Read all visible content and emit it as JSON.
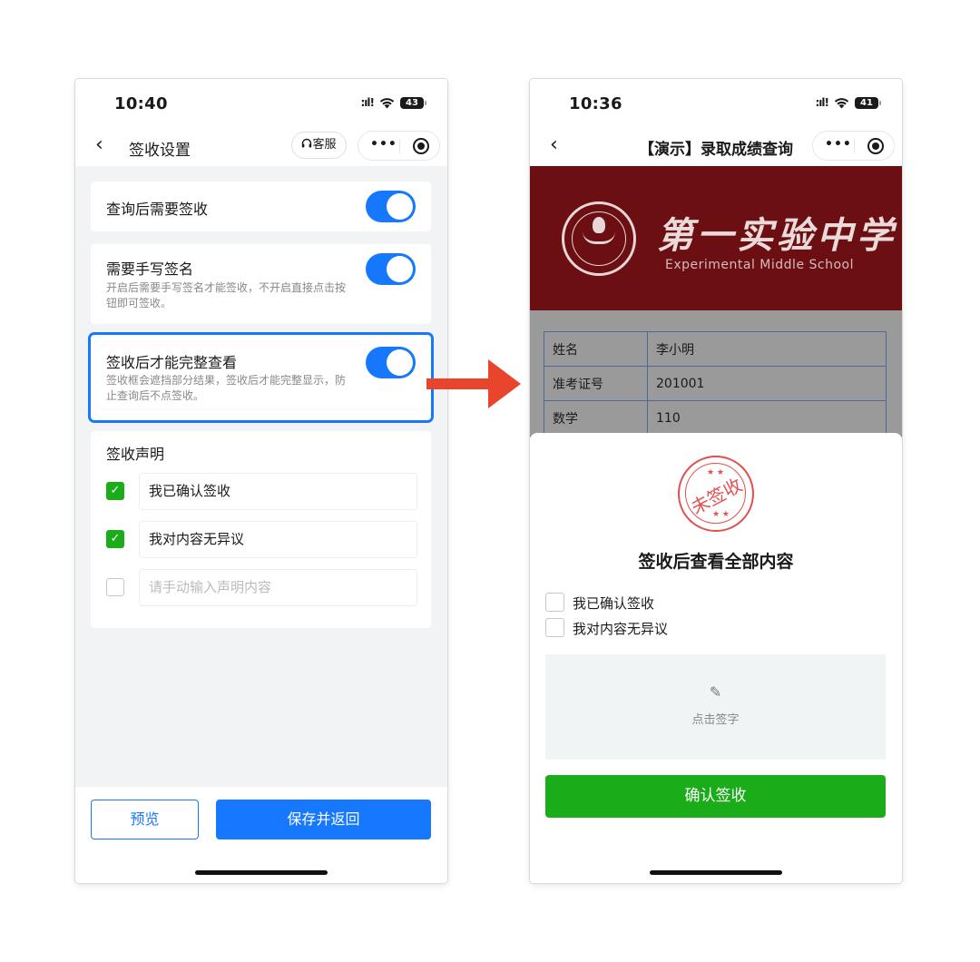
{
  "left": {
    "status": {
      "time": "10:40",
      "signal": ":ıl!",
      "wifi": "wifi-icon",
      "battery": "43"
    },
    "nav": {
      "back": "‹",
      "title": "签收设置",
      "kefu": "客服",
      "more": "•••"
    },
    "settings": [
      {
        "title": "查询后需要签收",
        "desc": "",
        "enabled": true
      },
      {
        "title": "需要手写签名",
        "desc": "开启后需要手写签名才能签收，不开启直接点击按钮即可签收。",
        "enabled": true
      },
      {
        "title": "签收后才能完整查看",
        "desc": "签收框会遮挡部分结果，签收后才能完整显示，防止查询后不点签收。",
        "enabled": true,
        "highlighted": true
      }
    ],
    "statement": {
      "title": "签收声明",
      "items": [
        {
          "text": "我已确认签收",
          "checked": true,
          "check_mark": "✓"
        },
        {
          "text": "我对内容无异议",
          "checked": true,
          "check_mark": "✓"
        },
        {
          "text": "请手动输入声明内容",
          "checked": false,
          "placeholder": true
        }
      ]
    },
    "buttons": {
      "preview": "预览",
      "save": "保存并返回"
    },
    "colors": {
      "primary": "#1677ff",
      "check_green": "#1aad19"
    }
  },
  "right": {
    "status": {
      "time": "10:36",
      "signal": ":ıl!",
      "wifi": "wifi-icon",
      "battery": "41"
    },
    "nav": {
      "back": "‹",
      "title": "【演示】录取成绩查询",
      "more": "•••"
    },
    "banner": {
      "school_cn": "第一实验中学",
      "school_en": "Experimental Middle School",
      "color": "#6b0f12"
    },
    "results": [
      {
        "key": "姓名",
        "value": "李小明"
      },
      {
        "key": "准考证号",
        "value": "201001"
      },
      {
        "key": "数学",
        "value": "110"
      }
    ],
    "sheet": {
      "stamp": "未签收",
      "title": "签收后查看全部内容",
      "checks": [
        {
          "text": "我已确认签收",
          "checked": false
        },
        {
          "text": "我对内容无异议",
          "checked": false
        }
      ],
      "sign_icon": "pen-icon",
      "sign_glyph": "✎",
      "sign_label": "点击签字",
      "confirm": "确认签收"
    },
    "colors": {
      "confirm_green": "#1aad19",
      "stamp_red": "#e25050"
    }
  },
  "arrow_color": "#e8452c"
}
